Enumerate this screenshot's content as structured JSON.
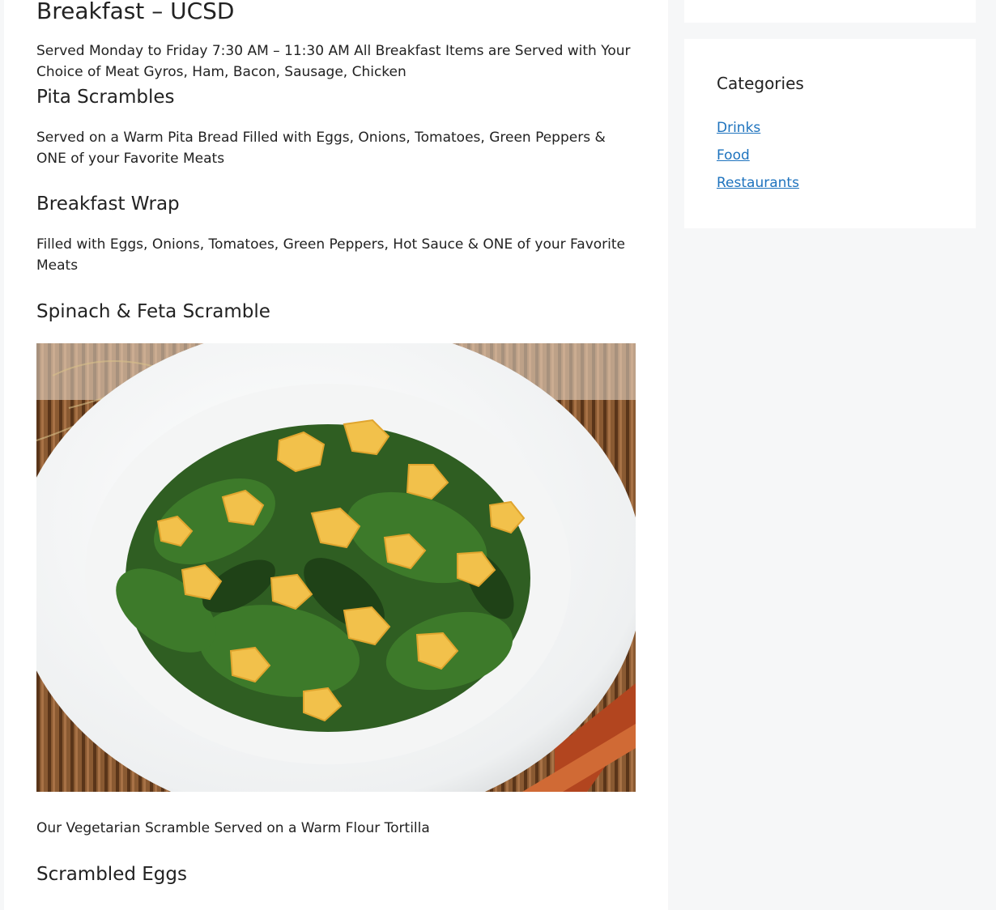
{
  "main": {
    "title": "Breakfast – UCSD",
    "intro": "Served Monday to Friday 7:30 AM – 11:30 AM All Breakfast Items are Served with Your Choice of Meat Gyros, Ham, Bacon, Sausage, Chicken",
    "items": [
      {
        "heading": "Pita Scrambles",
        "description": "Served on a Warm Pita Bread Filled with Eggs, Onions, Tomatoes, Green Peppers & ONE of your Favorite Meats"
      },
      {
        "heading": "Breakfast Wrap",
        "description": "Filled with Eggs, Onions, Tomatoes, Green Peppers, Hot Sauce  & ONE of your Favorite Meats"
      },
      {
        "heading": "Spinach & Feta Scramble",
        "description": "Our Vegetarian Scramble Served on a Warm Flour Tortilla"
      },
      {
        "heading": "Scrambled Eggs"
      }
    ],
    "photo": {
      "subject": "spinach and scrambled egg plate"
    }
  },
  "sidebar": {
    "widget_title": "Categories",
    "categories": [
      "Drinks",
      "Food",
      "Restaurants"
    ],
    "link_color": "#1e73be"
  }
}
